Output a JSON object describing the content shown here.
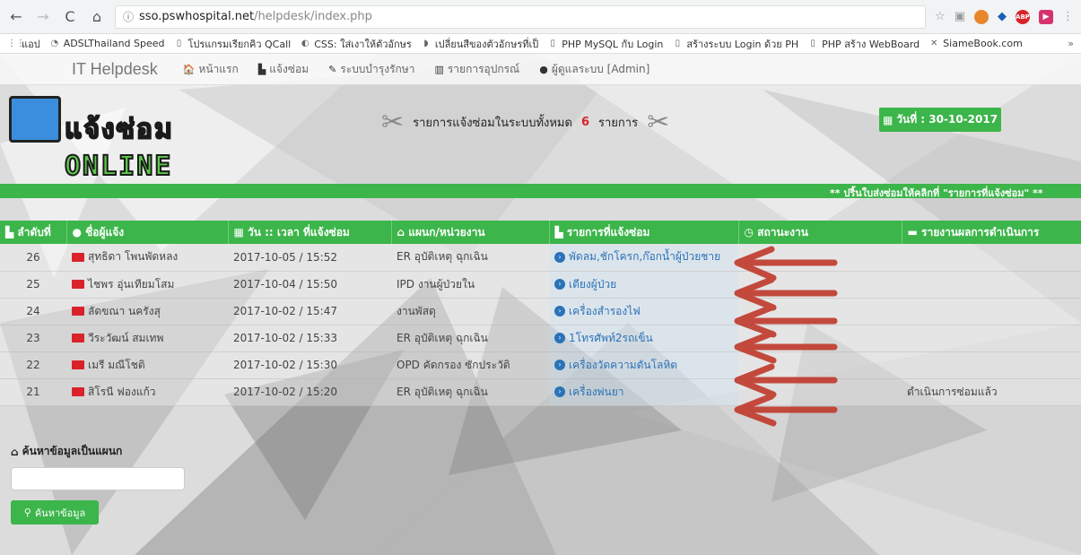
{
  "browser": {
    "url_domain": "sso.pswhospital.net",
    "url_path": "/helpdesk/index.php",
    "bookmarks": [
      "แอป",
      "ADSLThailand Speed",
      "โปรแกรมเรียกคิว QCall",
      "CSS: ใส่เงาให้ตัวอักษร",
      "เปลี่ยนสีของตัวอักษรที่เป็",
      "PHP MySQL กับ Login",
      "สร้างระบบ Login ด้วย PH",
      "PHP สร้าง WebBoard",
      "SiameBook.com"
    ],
    "bookmarks_more": "»"
  },
  "navbar": {
    "brand": "IT Helpdesk",
    "items": [
      {
        "label": "หน้าแรก",
        "icon": "home-icon"
      },
      {
        "label": "แจ้งซ่อม",
        "icon": "file-icon"
      },
      {
        "label": "ระบบบำรุงรักษา",
        "icon": "wrench-icon"
      },
      {
        "label": "รายการอุปกรณ์",
        "icon": "barcode-icon"
      },
      {
        "label": "ผู้ดูแลระบบ [Admin]",
        "icon": "user-icon"
      }
    ]
  },
  "header": {
    "logo_text_a": "แจ้งซ่อม",
    "logo_text_b": "ONLINE",
    "summary_prefix": "รายการแจ้งซ่อมในระบบทั้งหมด",
    "summary_count": "6",
    "summary_suffix": "รายการ",
    "date_label": "วันที่ : 30-10-2017"
  },
  "ticker": "** ปริ้นใบส่งซ่อมให้คลิกที่ \"รายการที่แจ้งซ่อม\" **",
  "table": {
    "columns": [
      "ลำดับที่",
      "ชื่อผู้แจ้ง",
      "วัน :: เวลา ที่แจ้งซ่อม",
      "แผนก/หน่วยงาน",
      "รายการที่แจ้งซ่อม",
      "สถานะงาน",
      "รายงานผลการดำเนินการ"
    ],
    "rows": [
      {
        "no": "26",
        "name": "สุทธิดา โพนพัดหลง",
        "datetime": "2017-10-05 / 15:52",
        "dept": "ER อุบัติเหตุ ฉุกเฉิน",
        "item": "พัดลม,ชักโครก,ก๊อกน้ำผู้ป่วยชาย",
        "status": "",
        "report": ""
      },
      {
        "no": "25",
        "name": "ไชพร อุ่นเทียมโสม",
        "datetime": "2017-10-04 / 15:50",
        "dept": "IPD งานผู้ป่วยใน",
        "item": "เตียงผู้ป่วย",
        "status": "",
        "report": ""
      },
      {
        "no": "24",
        "name": "ลัดขณา นครังสุ",
        "datetime": "2017-10-02 / 15:47",
        "dept": "งานพัสดุ",
        "item": "เครื่องสำรองไฟ",
        "status": "",
        "report": ""
      },
      {
        "no": "23",
        "name": "วีระวัฒน์ สมเทพ",
        "datetime": "2017-10-02 / 15:33",
        "dept": "ER อุบัติเหตุ ฉุกเฉิน",
        "item": "1โทรศัพท์2รถเข็น",
        "status": "",
        "report": ""
      },
      {
        "no": "22",
        "name": "เมรี มณีโชติ",
        "datetime": "2017-10-02 / 15:30",
        "dept": "OPD คัดกรอง ซักประวัติ",
        "item": "เครื่องวัดความดันโลหิต",
        "status": "",
        "report": ""
      },
      {
        "no": "21",
        "name": "สิโรนี ฟองแก้ว",
        "datetime": "2017-10-02 / 15:20",
        "dept": "ER อุบัติเหตุ ฉุกเฉิน",
        "item": "เครื่องพ่นยา",
        "status": "",
        "report": "ดำเนินการซ่อมแล้ว"
      }
    ]
  },
  "search": {
    "label": "ค้นหาข้อมูลเป็นแผนก",
    "button": "ค้นหาข้อมูล",
    "value": ""
  },
  "colors": {
    "accent": "#3cb54a",
    "link": "#2a73b8",
    "alert": "#d9222a",
    "arrow": "#c0392b"
  }
}
